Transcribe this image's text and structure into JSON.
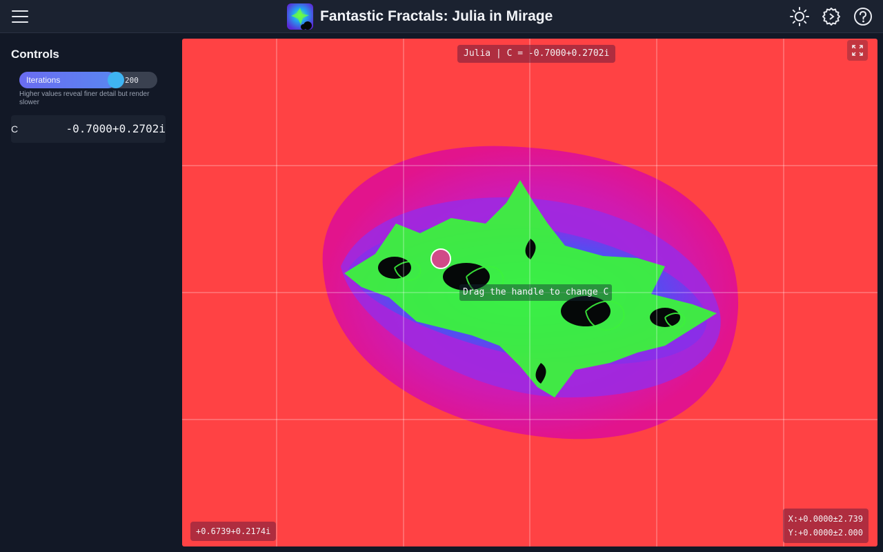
{
  "header": {
    "title": "Fantastic Fractals: Julia in Mirage",
    "menu_icon": "hamburger-menu-icon",
    "logo_icon": "fractal-logo-icon",
    "icons": [
      "sun-icon",
      "settings-gear-icon",
      "help-circle-icon"
    ]
  },
  "sidebar": {
    "title": "Controls",
    "iterations": {
      "label": "Iterations",
      "value": "200",
      "fill_fraction": 0.7,
      "hint": "Higher values reveal finer detail but render slower"
    },
    "c_param": {
      "label": "C",
      "value": "-0.7000+0.2702i"
    }
  },
  "canvas": {
    "top_label": "Julia | C = -0.7000+0.2702i",
    "drag_hint": "Drag the handle to change C",
    "cursor_readout": "+0.6739+0.2174i",
    "range_x": "X:+0.0000±2.739",
    "range_y": "Y:+0.0000±2.000",
    "expand_icon": "expand-fullscreen-icon",
    "handle_icon": "c-handle-icon",
    "colors": {
      "background": "#ff4244",
      "halo_outer": "#e2148c",
      "halo_inner": "#a822d8",
      "core_blue": "#2e7cf4",
      "filament": "#3cf23c",
      "interior": "#050808"
    }
  }
}
